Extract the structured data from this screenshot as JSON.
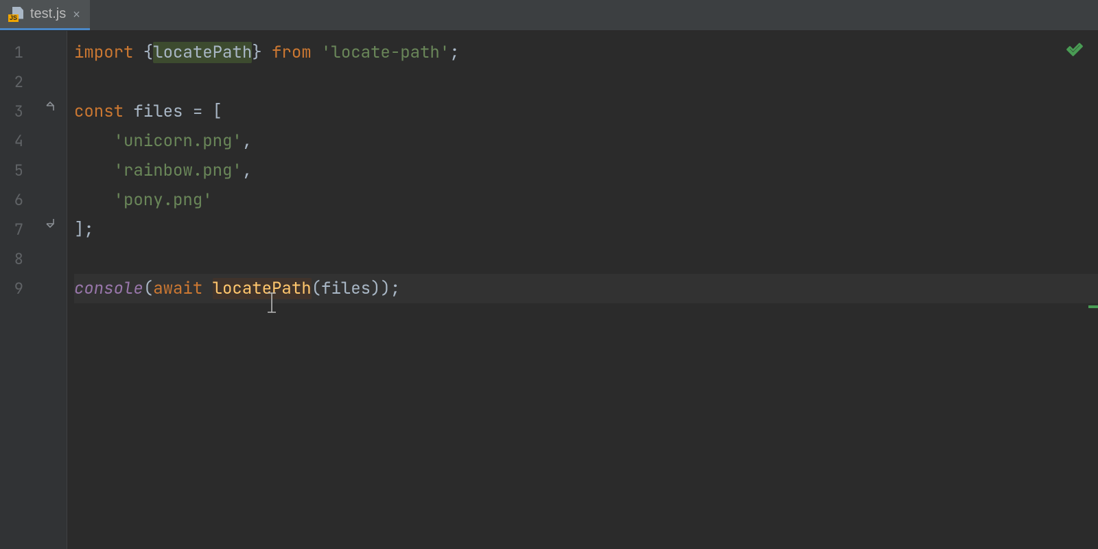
{
  "tab": {
    "filename": "test.js",
    "icon_badge": "JS"
  },
  "gutter": {
    "lines": [
      "1",
      "2",
      "3",
      "4",
      "5",
      "6",
      "7",
      "8",
      "9"
    ]
  },
  "code": {
    "l1": {
      "kw1": "import",
      "brace_l": " {",
      "ident": "locatePath",
      "brace_r": "}",
      "kw2": " from ",
      "str": "'locate-path'",
      "end": ";"
    },
    "l2": "",
    "l3": {
      "kw": "const",
      "ident": " files ",
      "eq": "= [",
      "rest": ""
    },
    "l4": {
      "indent": "    ",
      "str": "'unicorn.png'",
      "comma": ","
    },
    "l5": {
      "indent": "    ",
      "str": "'rainbow.png'",
      "comma": ","
    },
    "l6": {
      "indent": "    ",
      "str": "'pony.png'"
    },
    "l7": {
      "close": "];"
    },
    "l8": "",
    "l9": {
      "console": "console",
      "p1": "(",
      "await": "await ",
      "fn": "locatePath",
      "p2": "(",
      "arg": "files",
      "p3": "));"
    }
  },
  "colors": {
    "background": "#2b2b2b",
    "gutter": "#313335",
    "keyword": "#cc7832",
    "string": "#6a8759",
    "function": "#ffc66d",
    "identifier": "#a9b7c6",
    "accent_tab": "#4a88c7",
    "ok_green": "#499c54"
  }
}
